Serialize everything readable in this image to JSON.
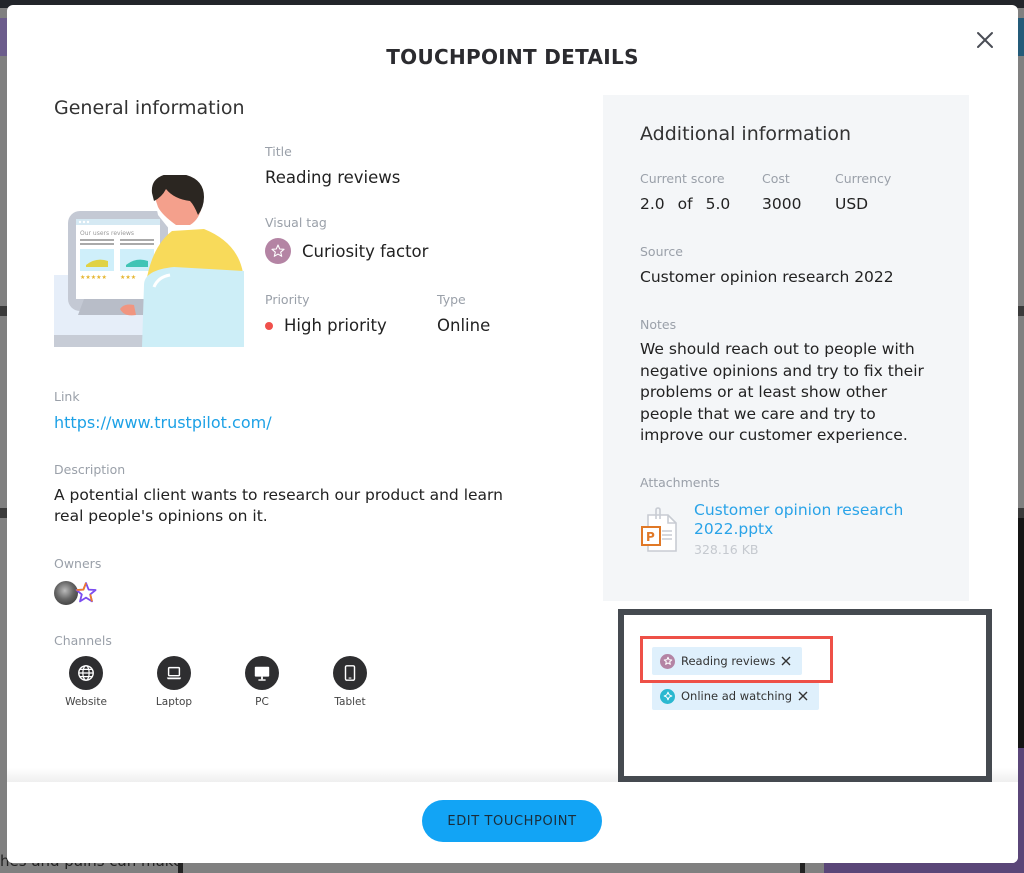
{
  "modal": {
    "title": "TOUCHPOINT DETAILS",
    "close_icon": "close-icon"
  },
  "general": {
    "heading": "General information",
    "illustration": {
      "icon": "person-reading-reviews-illustration",
      "screen_text": "Our users reviews"
    },
    "title_label": "Title",
    "title_value": "Reading reviews",
    "visual_tag_label": "Visual tag",
    "visual_tag_value": "Curiosity factor",
    "visual_tag_icon": "star-icon",
    "visual_tag_color": "#b484a4",
    "priority_label": "Priority",
    "priority_value": "High priority",
    "priority_color": "#f0504b",
    "type_label": "Type",
    "type_value": "Online",
    "link_label": "Link",
    "link_value": "https://www.trustpilot.com/",
    "description_label": "Description",
    "description_value": "A potential client wants to research our product and learn real people's opinions on it.",
    "owners_label": "Owners",
    "owners": [
      {
        "icon": "user-avatar"
      },
      {
        "icon": "star-logo-avatar"
      }
    ],
    "channels_label": "Channels",
    "channels": [
      {
        "label": "Website",
        "icon": "globe-icon"
      },
      {
        "label": "Laptop",
        "icon": "laptop-icon"
      },
      {
        "label": "PC",
        "icon": "monitor-icon"
      },
      {
        "label": "Tablet",
        "icon": "tablet-icon"
      }
    ]
  },
  "additional": {
    "heading": "Additional information",
    "score_label": "Current score",
    "score_value": "2.0",
    "score_of": "of",
    "score_max": "5.0",
    "cost_label": "Cost",
    "cost_value": "3000",
    "currency_label": "Currency",
    "currency_value": "USD",
    "source_label": "Source",
    "source_value": "Customer opinion research 2022",
    "notes_label": "Notes",
    "notes_value": "We should reach out to people with negative opinions and try to fix their problems or at least show other people that we care and try to improve our customer experience.",
    "attachments_label": "Attachments",
    "attachment": {
      "name": "Customer opinion research 2022.pptx",
      "size": "328.16 KB",
      "icon": "powerpoint-file-icon"
    }
  },
  "chips": [
    {
      "label": "Reading reviews",
      "icon": "star-icon",
      "color": "#b484a4",
      "highlighted": true
    },
    {
      "label": "Online ad watching",
      "icon": "sparkle-icon",
      "color": "#2bb8d0",
      "highlighted": false
    }
  ],
  "footer": {
    "edit_button": "EDIT TOUCHPOINT",
    "button_color": "#12a4f5"
  },
  "background": {
    "partial_text": "hes and pains can make"
  }
}
